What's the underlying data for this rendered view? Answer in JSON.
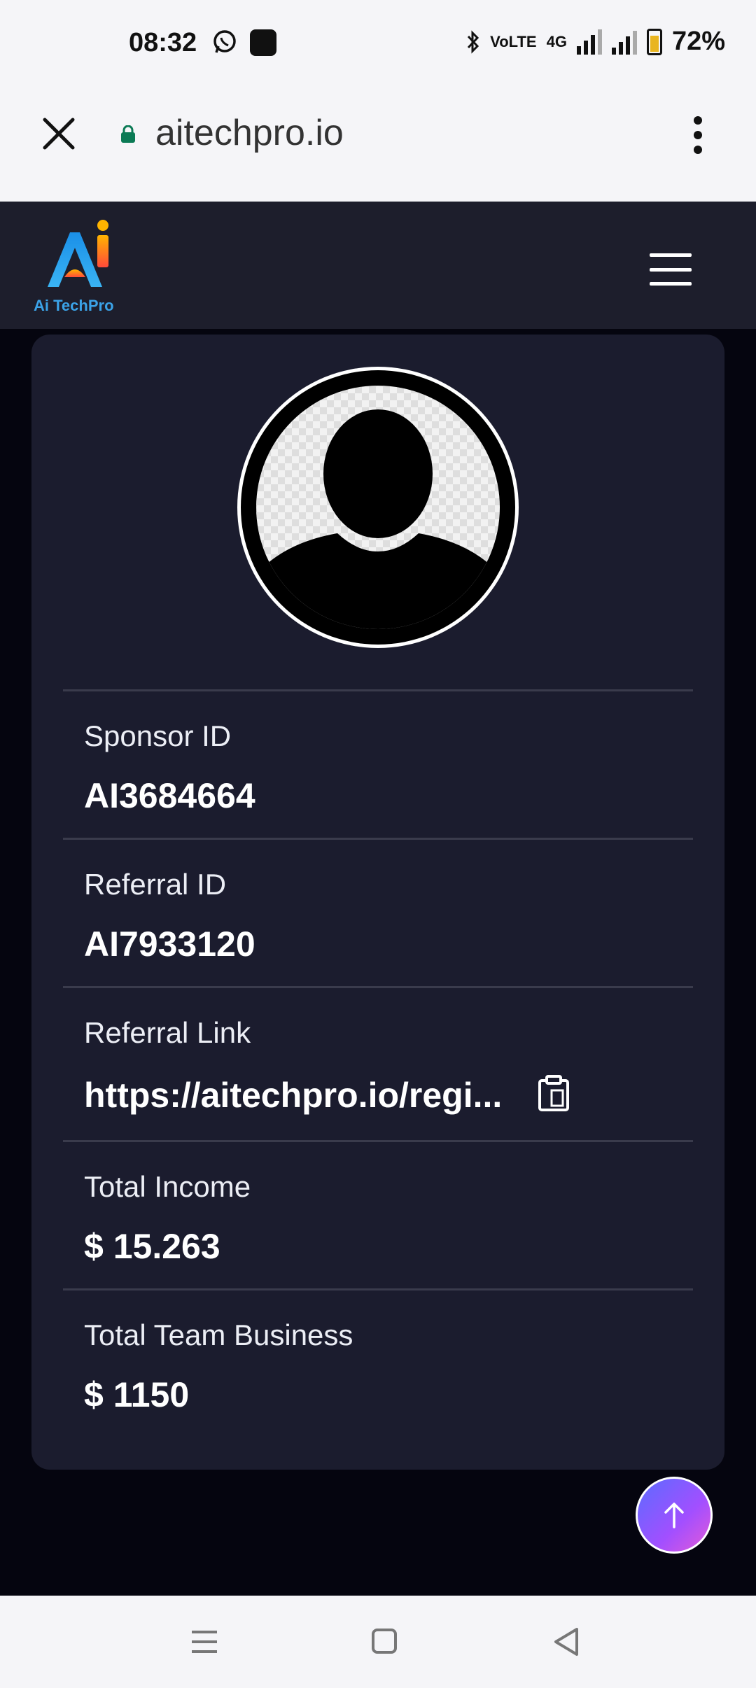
{
  "status_bar": {
    "time": "08:32",
    "network_label": "4G",
    "volte_label": "VoLTE",
    "battery": "72%"
  },
  "browser": {
    "url": "aitechpro.io"
  },
  "site": {
    "logo_text": "Ai TechPro"
  },
  "profile": {
    "fields": [
      {
        "label": "Sponsor ID",
        "value": "AI3684664"
      },
      {
        "label": "Referral ID",
        "value": "AI7933120"
      },
      {
        "label": "Referral Link",
        "value": "https://aitechpro.io/regi..."
      },
      {
        "label": "Total Income",
        "value": "$ 15.263"
      },
      {
        "label": "Total Team Business",
        "value": "$ 1150"
      }
    ]
  },
  "colors": {
    "background": "#05050f",
    "card": "#1b1c2e",
    "header": "#1d1e2c",
    "accent_gradient_start": "#5b6cff",
    "accent_gradient_end": "#e35ad8"
  }
}
